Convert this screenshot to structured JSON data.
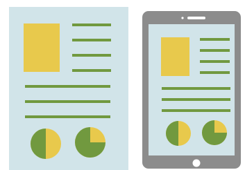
{
  "colors": {
    "background": "#ffffff",
    "page_fill": "#d1e4e9",
    "image_block": "#e8c94c",
    "text_line": "#71993f",
    "pie_dark": "#71993f",
    "pie_light": "#e8c94c",
    "tablet_frame": "#8c8c8c",
    "tablet_hardware": "#ffffff"
  },
  "document": {
    "image_block_icon": "image-placeholder",
    "side_line_count": 4,
    "body_line_count": 3,
    "pie_charts": [
      {
        "dark_fraction": 0.5
      },
      {
        "dark_fraction": 0.75
      }
    ]
  },
  "tablet": {
    "camera_icon": "camera-dot",
    "speaker_icon": "speaker-slot",
    "home_button_icon": "home-button",
    "side_line_count": 4,
    "body_line_count": 3,
    "pie_charts": [
      {
        "dark_fraction": 0.5
      },
      {
        "dark_fraction": 0.75
      }
    ]
  }
}
